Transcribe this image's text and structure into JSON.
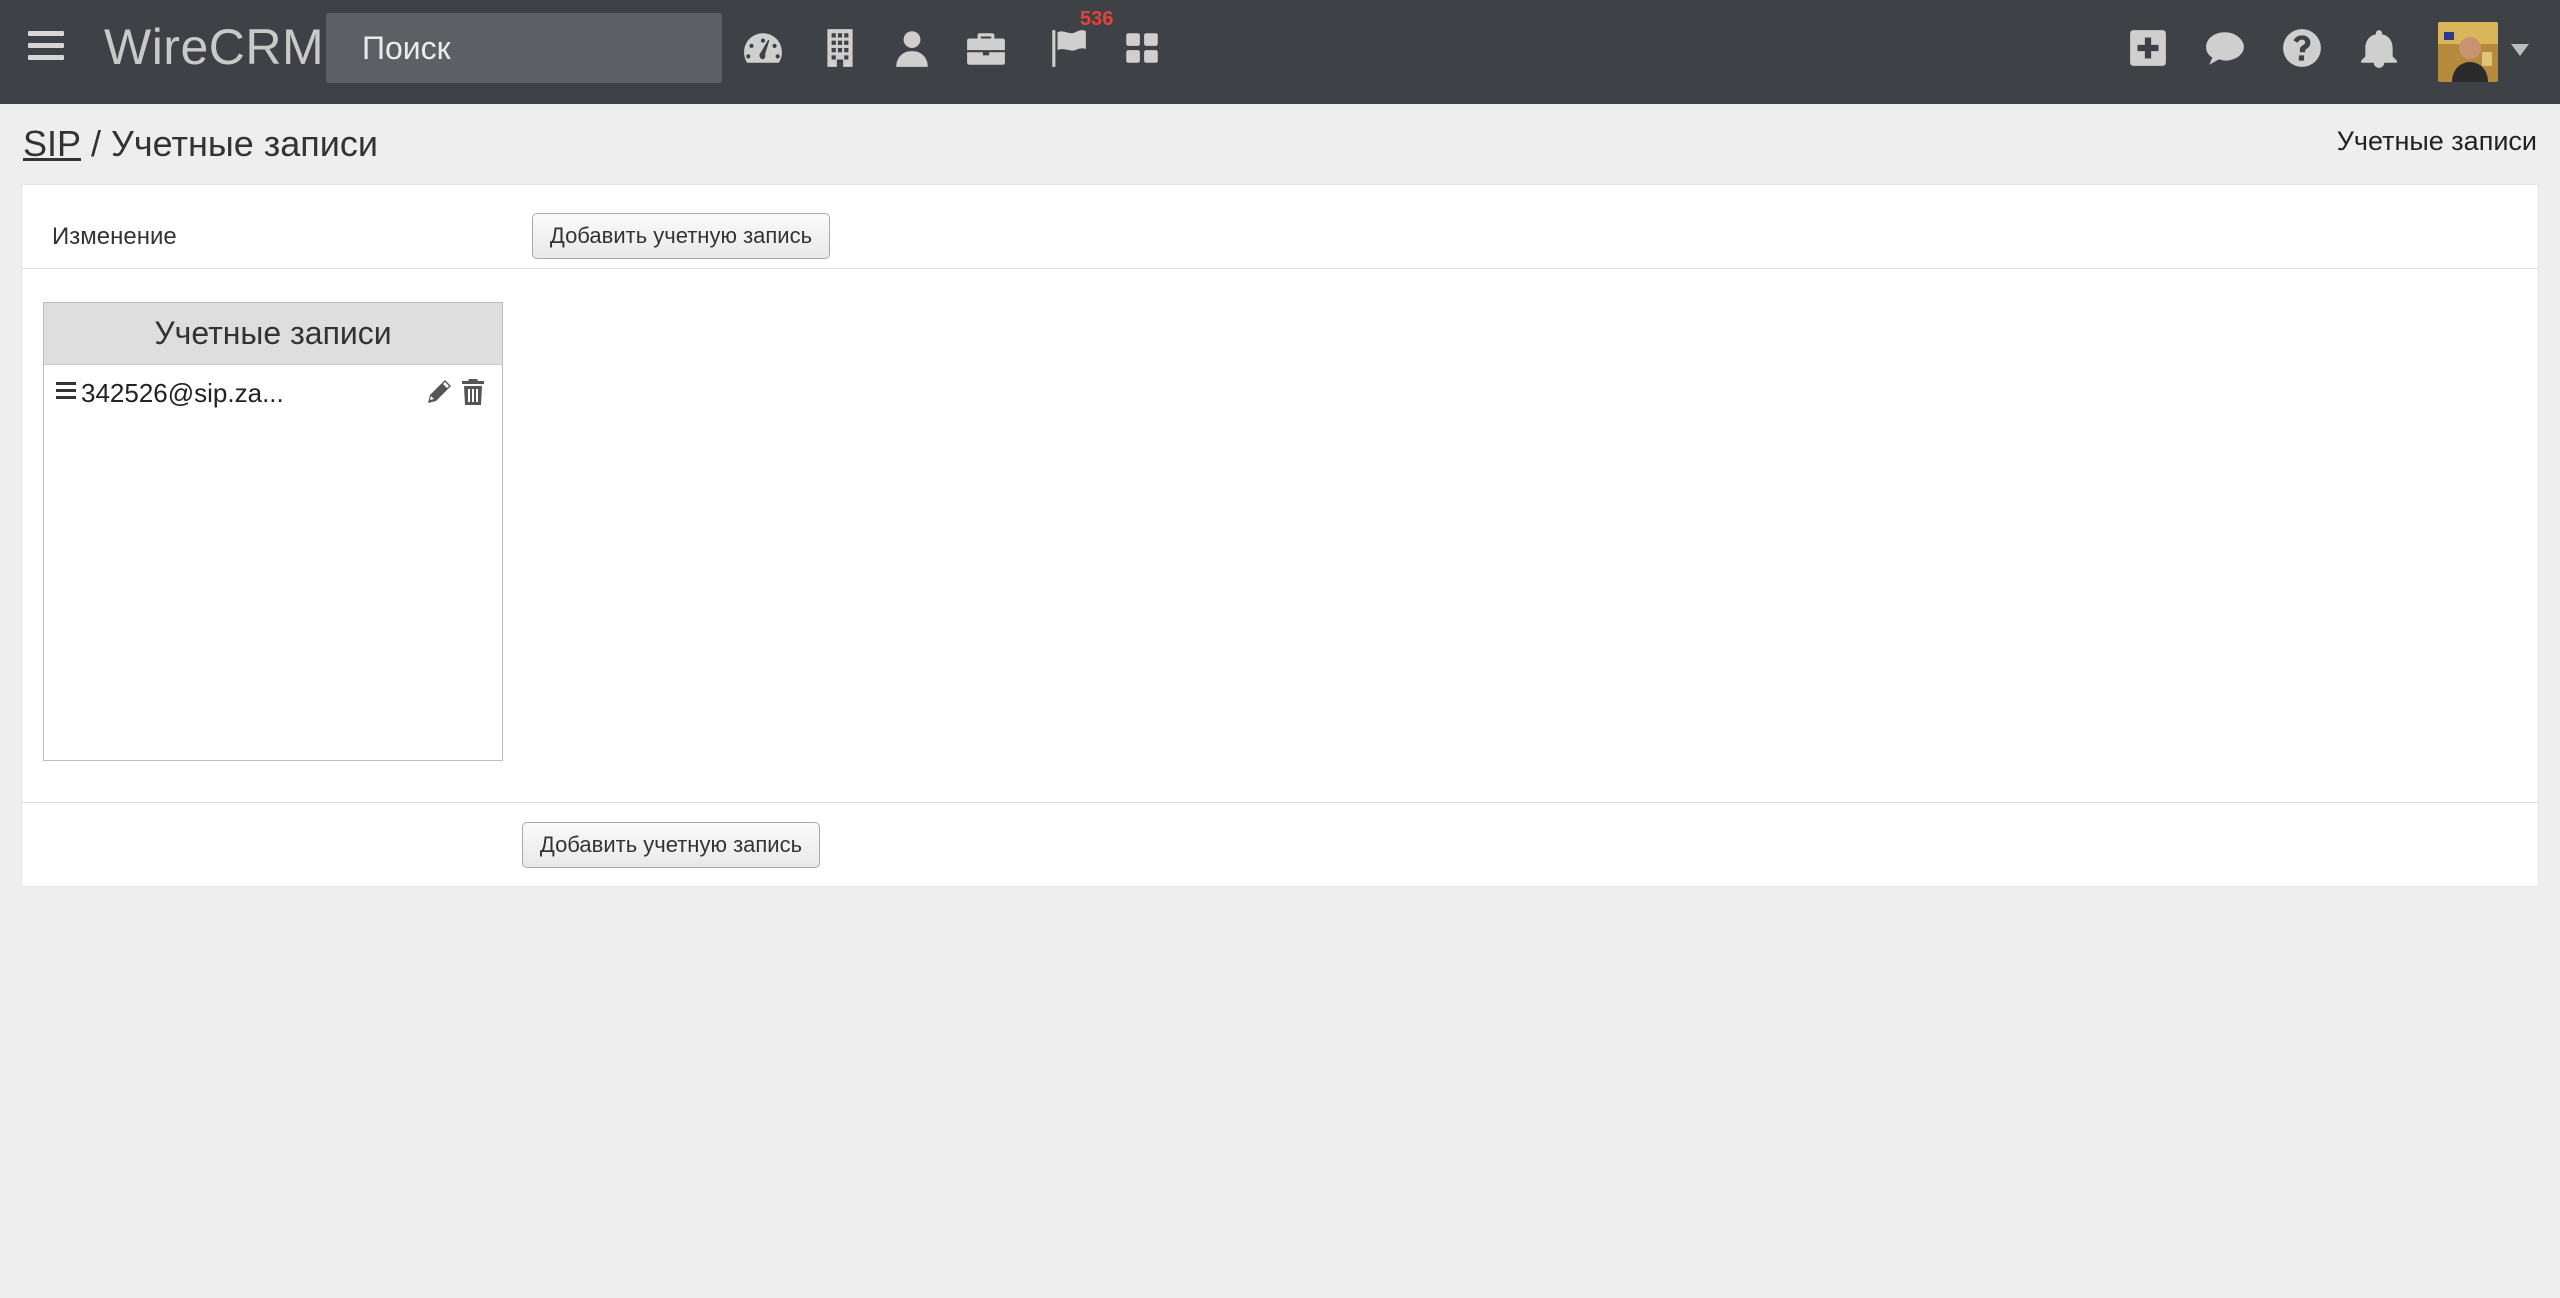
{
  "app": {
    "brand": "WireCRM",
    "search_placeholder": "Поиск"
  },
  "nav": {
    "icons": [
      "hamburger-menu-icon",
      "dashboard-icon",
      "building-icon",
      "user-icon",
      "briefcase-icon",
      "flag-icon",
      "apps-grid-icon",
      "plus-square-icon",
      "chat-icon",
      "help-icon",
      "bell-icon"
    ],
    "flag_badge": "536",
    "badge_color": "#e8413c",
    "navbar_color": "#3e4247"
  },
  "breadcrumb": {
    "root": "SIP",
    "separator": "/",
    "current": "Учетные записи",
    "right_title": "Учетные записи"
  },
  "panel": {
    "change_label": "Изменение",
    "add_button_label": "Добавить учетную запись",
    "list": {
      "title": "Учетные записи",
      "items": [
        {
          "label": "342526@sip.za..."
        }
      ]
    }
  }
}
